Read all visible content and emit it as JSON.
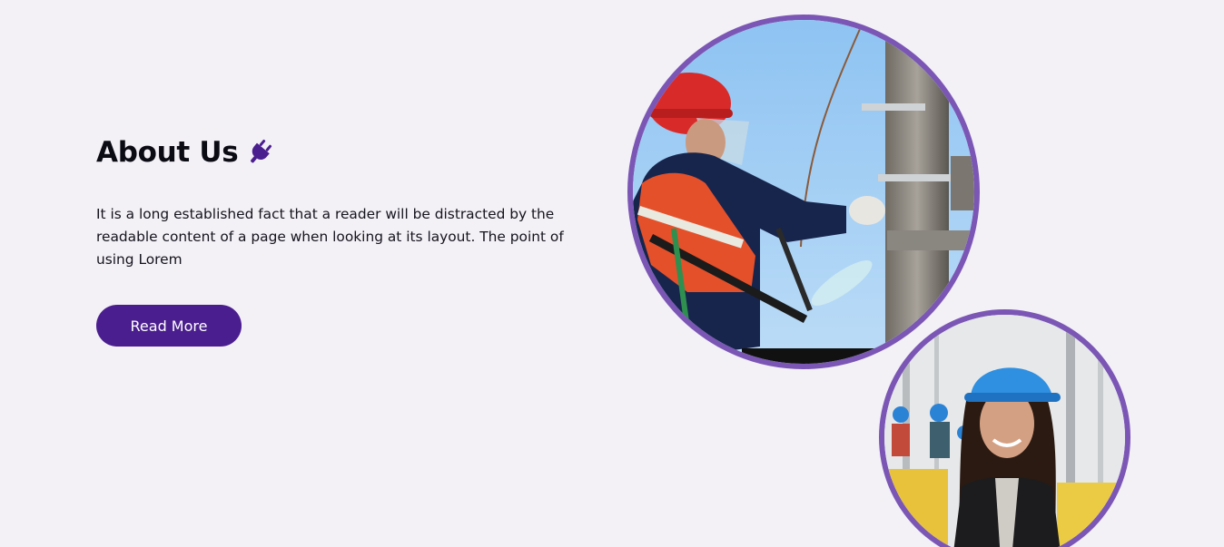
{
  "about": {
    "title": "About Us",
    "title_icon": "plug-icon",
    "body": "It is a long established fact that a reader will be distracted by the readable content of a page when looking at its layout. The point of using Lorem",
    "button_label": "Read More"
  },
  "images": {
    "large": "lineman-on-utility-pole-photo",
    "small": "smiling-engineer-blue-helmet-photo"
  },
  "colors": {
    "background": "#f3f0f6",
    "accent": "#4a1e8f",
    "ring": "#7b56b5",
    "text": "#0b0b14"
  }
}
